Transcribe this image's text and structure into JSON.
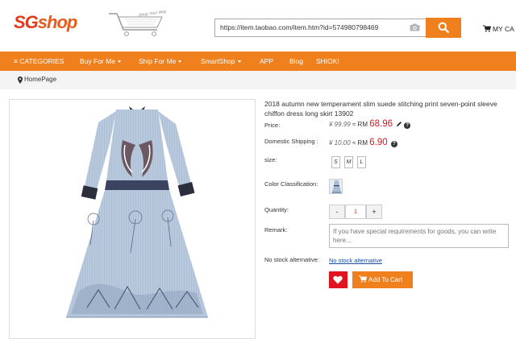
{
  "brand": {
    "logo_mark": "SG",
    "logo_word": "shop",
    "cart_tagline": "Shop Your Way"
  },
  "search": {
    "value": "https://item.taobao.com/item.htm?id=574980798469"
  },
  "header": {
    "cart_label": "MY CA"
  },
  "nav": {
    "items": [
      {
        "label": "≡ CATEGORIES"
      },
      {
        "label": "Buy For Me"
      },
      {
        "label": "Ship For Me"
      },
      {
        "label": "SmartShop"
      },
      {
        "label": "APP"
      },
      {
        "label": "Blog"
      },
      {
        "label": "SHIOK!"
      }
    ]
  },
  "breadcrumb": {
    "home": "HomePage"
  },
  "product": {
    "title": "2018 autumn new temperament slim suede stitching print seven-point sleeve chiffon dress long skirt 13902",
    "price_label": "Price:",
    "price_cny": "¥ 99.99",
    "price_approx": "≈ RM",
    "price_rm": "68.96",
    "shipping_label": "Domestic Shipping :",
    "shipping_cny": "¥ 10.00",
    "shipping_approx": "≈ RM",
    "shipping_rm": "6.90",
    "size_label": "size:",
    "sizes": [
      "S",
      "M",
      "L"
    ],
    "color_label": "Color Classification:",
    "quantity_label": "Quantity:",
    "qty_minus": "-",
    "quantity": "1",
    "qty_plus": "+",
    "remark_label": "Remark:",
    "remark_placeholder": "If you have special requirements for goods, you can write here...",
    "nostock_label": "No stock alternative:",
    "nostock_link": "No stock alternative",
    "add_to_cart": "Add To Cart",
    "help_glyph": "?"
  },
  "colors": {
    "accent": "#f0801e",
    "price_red": "#e0141e",
    "link_blue": "#1a4b9c"
  },
  "icons": [
    "camera-icon",
    "search-icon",
    "cart-icon",
    "map-marker-icon",
    "pencil-icon",
    "question-icon",
    "heart-icon"
  ]
}
